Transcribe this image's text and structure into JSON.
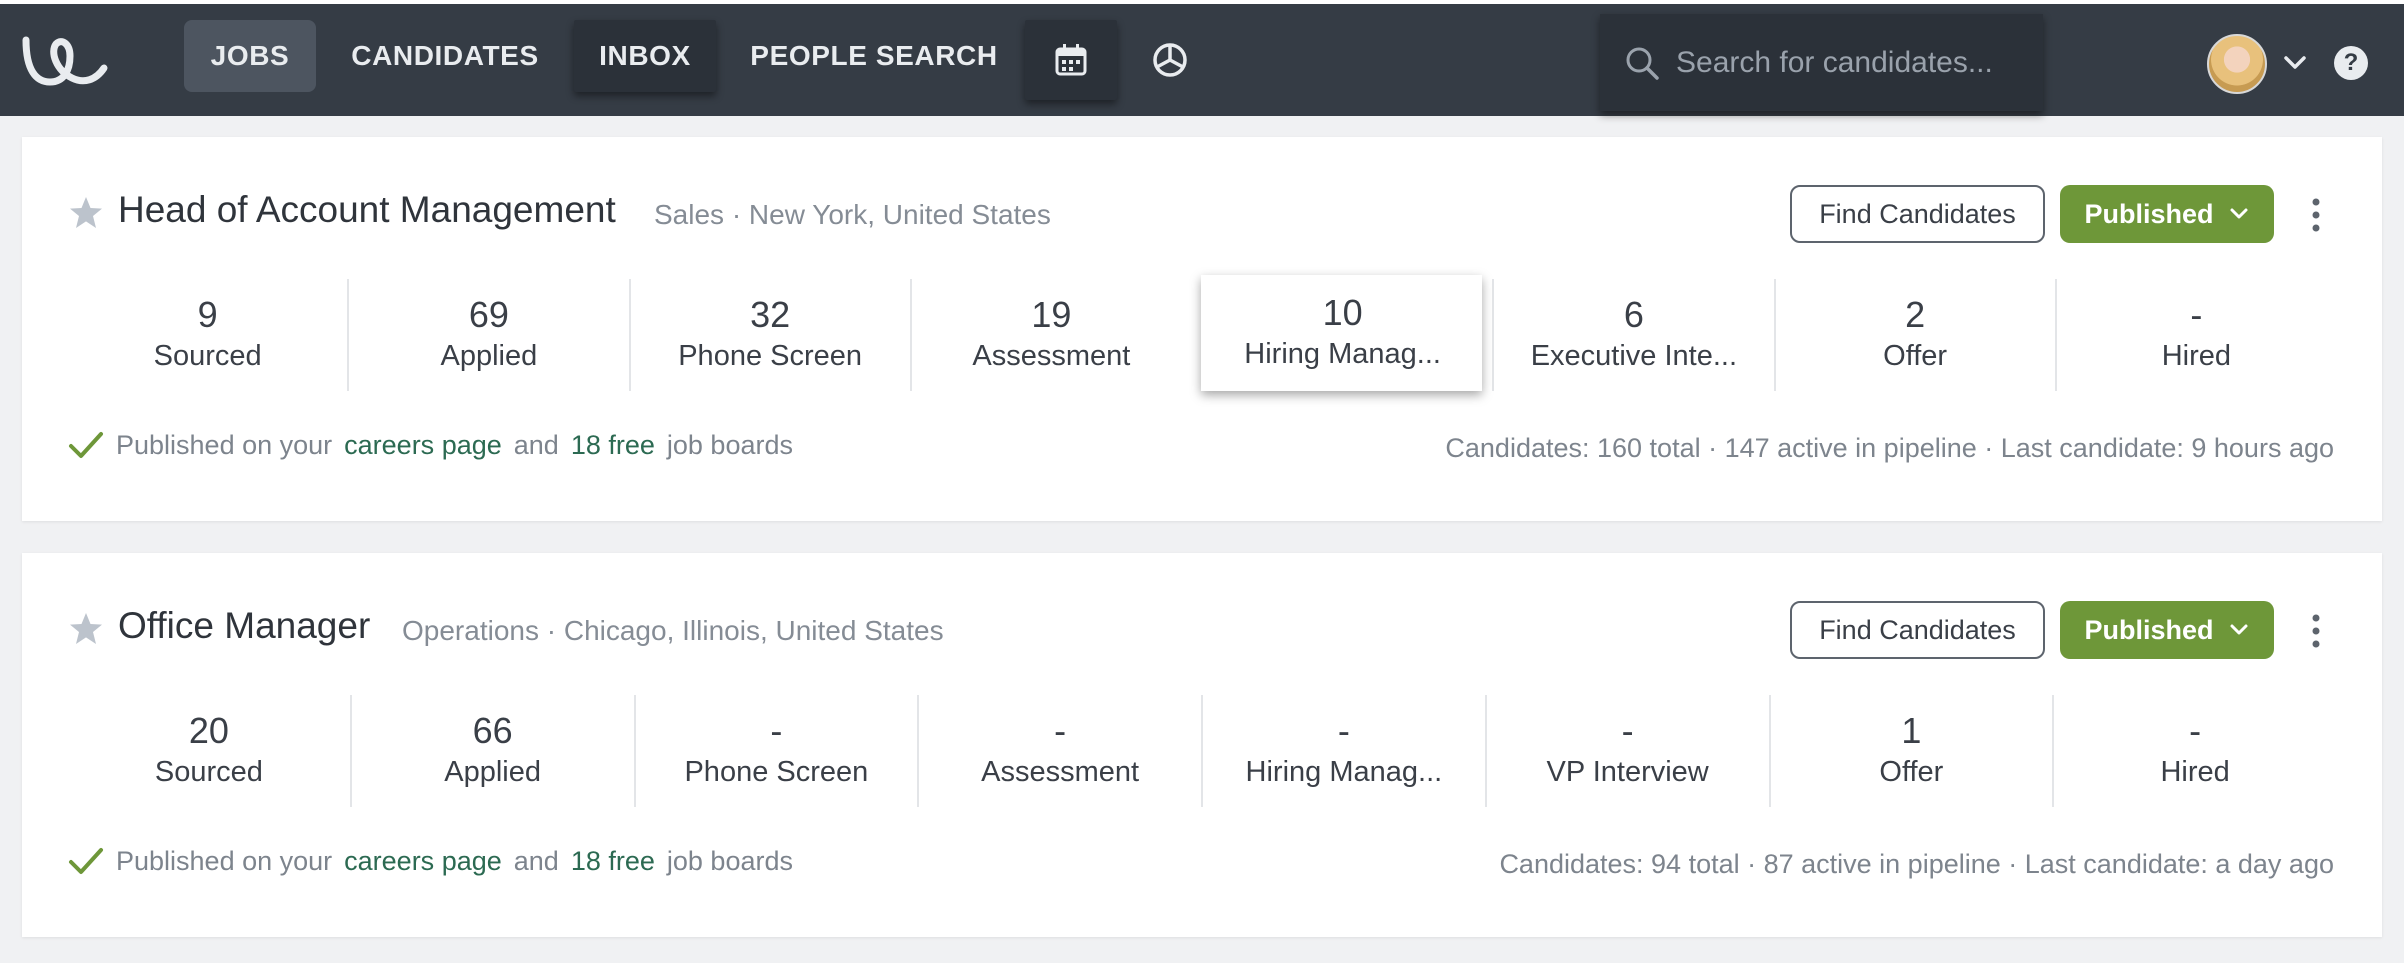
{
  "nav": {
    "items": [
      {
        "label": "JOBS"
      },
      {
        "label": "CANDIDATES"
      },
      {
        "label": "INBOX"
      },
      {
        "label": "PEOPLE SEARCH"
      }
    ],
    "search_placeholder": "Search for candidates...",
    "help_label": "?"
  },
  "jobs": [
    {
      "title": "Head of Account Management",
      "meta": "Sales · New York, United States",
      "find_label": "Find Candidates",
      "status_label": "Published",
      "stages": [
        {
          "count": "9",
          "label": "Sourced"
        },
        {
          "count": "69",
          "label": "Applied"
        },
        {
          "count": "32",
          "label": "Phone Screen"
        },
        {
          "count": "19",
          "label": "Assessment"
        },
        {
          "count": "10",
          "label": "Hiring Manag..."
        },
        {
          "count": "6",
          "label": "Executive Inte..."
        },
        {
          "count": "2",
          "label": "Offer"
        },
        {
          "count": "-",
          "label": "Hired"
        }
      ],
      "footer": {
        "prefix": "Published on your",
        "link1": "careers page",
        "mid": "and",
        "link2": "18 free",
        "suffix": "job boards",
        "stats": "Candidates: 160 total · 147 active in pipeline · Last candidate: 9 hours ago"
      }
    },
    {
      "title": "Office Manager",
      "meta": "Operations · Chicago, Illinois, United States",
      "find_label": "Find Candidates",
      "status_label": "Published",
      "stages": [
        {
          "count": "20",
          "label": "Sourced"
        },
        {
          "count": "66",
          "label": "Applied"
        },
        {
          "count": "-",
          "label": "Phone Screen"
        },
        {
          "count": "-",
          "label": "Assessment"
        },
        {
          "count": "-",
          "label": "Hiring Manag..."
        },
        {
          "count": "-",
          "label": "VP Interview"
        },
        {
          "count": "1",
          "label": "Offer"
        },
        {
          "count": "-",
          "label": "Hired"
        }
      ],
      "footer": {
        "prefix": "Published on your",
        "link1": "careers page",
        "mid": "and",
        "link2": "18 free",
        "suffix": "job boards",
        "stats": "Candidates: 94 total · 87 active in pipeline · Last candidate: a day ago"
      }
    }
  ],
  "colors": {
    "nav_bg": "#353c45",
    "published_green": "#6e9739",
    "link_green": "#2c6a52"
  }
}
